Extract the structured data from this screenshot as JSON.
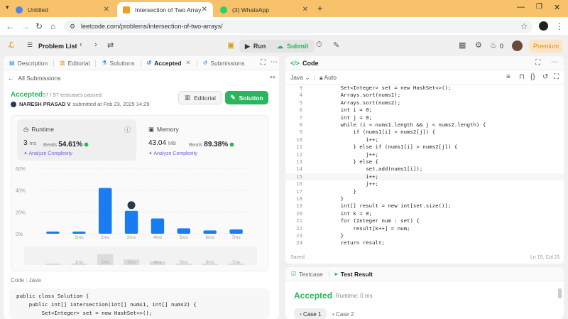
{
  "browser": {
    "tabs": [
      {
        "title": "Untitled"
      },
      {
        "title": "Intersection of Two Arrays - Lee"
      },
      {
        "title": "(3) WhatsApp"
      }
    ],
    "url": "leetcode.com/problems/intersection-of-two-arrays/"
  },
  "lc": {
    "problem_list": "Problem List",
    "run": "Run",
    "submit": "Submit",
    "streak": "0",
    "premium": "Premium"
  },
  "left": {
    "tabs": [
      "Description",
      "Editorial",
      "Solutions",
      "Accepted",
      "Submissions"
    ],
    "all_submissions": "All Submissions",
    "status": "Accepted",
    "passed": "57 / 57 testcases passed",
    "user": "NARESH PRASAD V",
    "submitted": "submitted at Feb 23, 2025 14:29",
    "editorial_btn": "Editorial",
    "solution_btn": "Solution",
    "runtime": {
      "label": "Runtime",
      "value": "3",
      "unit": "ms",
      "beats_label": "Beats",
      "beats": "54.61%"
    },
    "memory": {
      "label": "Memory",
      "value": "43.04",
      "unit": "MB",
      "beats_label": "Beats",
      "beats": "89.38%"
    },
    "analyze": "Analyze Complexity",
    "code_tab": "Code",
    "code_lang": "Java",
    "code_lines": [
      "public class Solution {",
      "    public int[] intersection(int[] nums1, int[] nums2) {",
      "        Set<Integer> set = new HashSet<>();"
    ]
  },
  "chart_data": {
    "type": "bar",
    "categories": [
      "",
      "",
      "2ms",
      "3ms",
      "4ms",
      "5ms",
      "6ms",
      "7ms"
    ],
    "tick_labels": [
      "1ms",
      "2ms",
      "3ms",
      "4ms",
      "5ms",
      "6ms",
      "7ms"
    ],
    "values": [
      2,
      2,
      42,
      21,
      14,
      5,
      3,
      4
    ],
    "yticks": [
      "60%",
      "40%",
      "20%",
      "0%"
    ],
    "ylim": [
      0,
      60
    ],
    "highlight_index": 3,
    "colors": {
      "bar": "#1a7cf2",
      "grid": "#e6e6e6"
    }
  },
  "right": {
    "title": "Code",
    "lang": "Java",
    "auto": "Auto",
    "saved": "Saved",
    "cursor": "Ln 15, Col 21",
    "lines": [
      {
        "n": "3",
        "t": "        Set<Integer> set = new HashSet<>();"
      },
      {
        "n": "4",
        "t": "        Arrays.sort(nums1);"
      },
      {
        "n": "5",
        "t": "        Arrays.sort(nums2);"
      },
      {
        "n": "6",
        "t": "        int i = 0;"
      },
      {
        "n": "7",
        "t": "        int j = 0;"
      },
      {
        "n": "8",
        "t": "        while (i < nums1.length && j < nums2.length) {"
      },
      {
        "n": "9",
        "t": "            if (nums1[i] < nums2[j]) {"
      },
      {
        "n": "10",
        "t": "                i++;"
      },
      {
        "n": "11",
        "t": "            } else if (nums1[i] > nums2[j]) {"
      },
      {
        "n": "12",
        "t": "                j++;"
      },
      {
        "n": "13",
        "t": "            } else {"
      },
      {
        "n": "14",
        "t": "                set.add(nums1[i]);"
      },
      {
        "n": "15",
        "t": "                i++;"
      },
      {
        "n": "16",
        "t": "                j++;"
      },
      {
        "n": "17",
        "t": "            }"
      },
      {
        "n": "18",
        "t": "        }"
      },
      {
        "n": "19",
        "t": "        int[] result = new int[set.size()];"
      },
      {
        "n": "20",
        "t": "        int k = 0;"
      },
      {
        "n": "21",
        "t": "        for (Integer num : set) {"
      },
      {
        "n": "22",
        "t": "            result[k++] = num;"
      },
      {
        "n": "23",
        "t": "        }"
      },
      {
        "n": "24",
        "t": "        return result;"
      }
    ]
  },
  "test": {
    "tab_testcase": "Testcase",
    "tab_result": "Test Result",
    "status": "Accepted",
    "runtime": "Runtime: 0 ms",
    "cases": [
      "Case 1",
      "Case 2"
    ]
  }
}
